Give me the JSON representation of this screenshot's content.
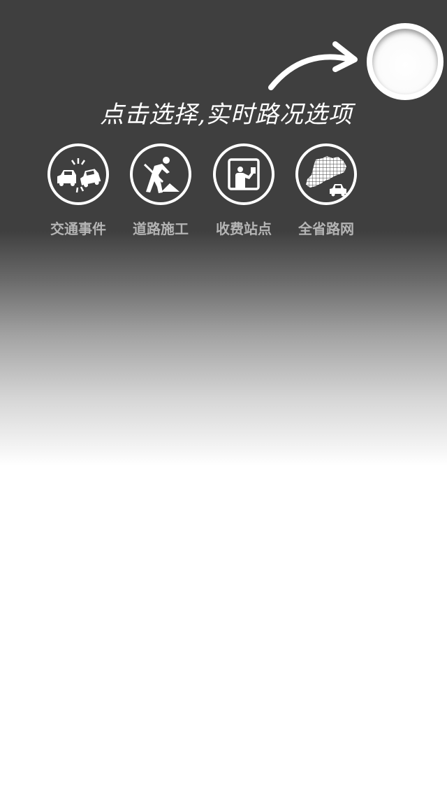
{
  "hint": {
    "text": "点击选择,实时路况选项"
  },
  "menu_button": {
    "icon": "menu-toggle-circle"
  },
  "options": [
    {
      "id": "traffic-incident",
      "label": "交通事件",
      "icon": "car-crash-icon"
    },
    {
      "id": "road-construction",
      "label": "道路施工",
      "icon": "road-worker-icon"
    },
    {
      "id": "toll-station",
      "label": "收费站点",
      "icon": "toll-booth-icon"
    },
    {
      "id": "province-road-network",
      "label": "全省路网",
      "icon": "province-map-icon"
    }
  ],
  "colors": {
    "overlay_dark": "#3f3f3f",
    "label_gray": "#b4b4b4",
    "icon_white": "#ffffff"
  }
}
